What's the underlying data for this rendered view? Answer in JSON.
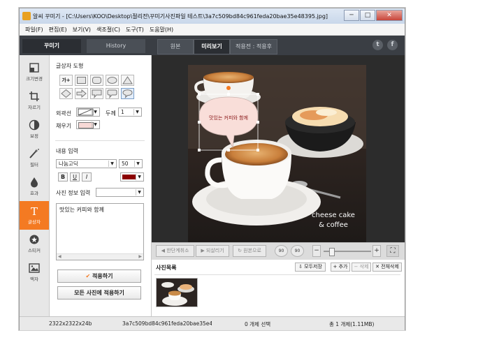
{
  "window": {
    "title": "알씨 꾸미기 - [C:\\Users\\KOO\\Desktop\\절리전\\꾸미기사진파일 테스트\\3a7c509bd84c961feda20bae35e48395.jpg]",
    "controls": [
      "─",
      "□",
      "✕"
    ]
  },
  "menu": [
    "파일(F)",
    "편집(E)",
    "보기(V)",
    "색조절(C)",
    "도구(T)",
    "도움말(H)"
  ],
  "left_tabs": {
    "decorate": "꾸미기",
    "history": "History"
  },
  "right_tabs": {
    "original": "원본",
    "preview": "미리보기",
    "before": "적용전 : 적용후"
  },
  "social": {
    "twitter": "t",
    "facebook": "f"
  },
  "tools": [
    {
      "label": "크기변경",
      "icon": "resize-icon"
    },
    {
      "label": "자르기",
      "icon": "crop-icon"
    },
    {
      "label": "보정",
      "icon": "adjust-icon"
    },
    {
      "label": "필터",
      "icon": "filter-icon"
    },
    {
      "label": "효과",
      "icon": "effect-icon"
    },
    {
      "label": "글상자",
      "icon": "textbox-icon"
    },
    {
      "label": "스티커",
      "icon": "sticker-icon"
    },
    {
      "label": "액자",
      "icon": "frame-icon"
    }
  ],
  "panel": {
    "shape_title": "글상자 도형",
    "shape_text_glyph": "가+",
    "outline_label": "외곽선",
    "thickness_label": "두께",
    "thickness_value": "1",
    "fill_label": "채우기",
    "content_title": "내용 입력",
    "font_value": "나눔고딕",
    "size_value": "50",
    "bold": "B",
    "underline": "U",
    "italic": "I",
    "photo_info_label": "사진 정보 입력",
    "photo_info_value": "",
    "text_value": "맛있는 커피와 함께",
    "apply_label": "적용하기",
    "apply_all_label": "모든 사진에 적용하기",
    "text_color": "#8b0000",
    "fill_color": "#f7d9d6",
    "accent": "#f47a22"
  },
  "canvas": {
    "bubble_text": "맛있는 커피와 함께",
    "caption_line1": "cheese cake",
    "caption_line2": "& coffee"
  },
  "toolbar": {
    "undo_label": "한단계취소",
    "redo_label": "되살리기",
    "original_label": "원본으로",
    "rotate_left": "90",
    "rotate_right": "90",
    "zoom_out": "−",
    "zoom_in": "+"
  },
  "photolist": {
    "title": "사진목록",
    "save_all": "모두저장",
    "add": "+ 추가",
    "delete": "− 삭제",
    "delete_all": "✕ 전체삭제"
  },
  "status": {
    "size": "2322x2322x24b",
    "filename": "3a7c509bd84c961feda20bae35e4839",
    "selected": "0 개체 선택",
    "total": "총 1 개체(1.11MB)"
  }
}
